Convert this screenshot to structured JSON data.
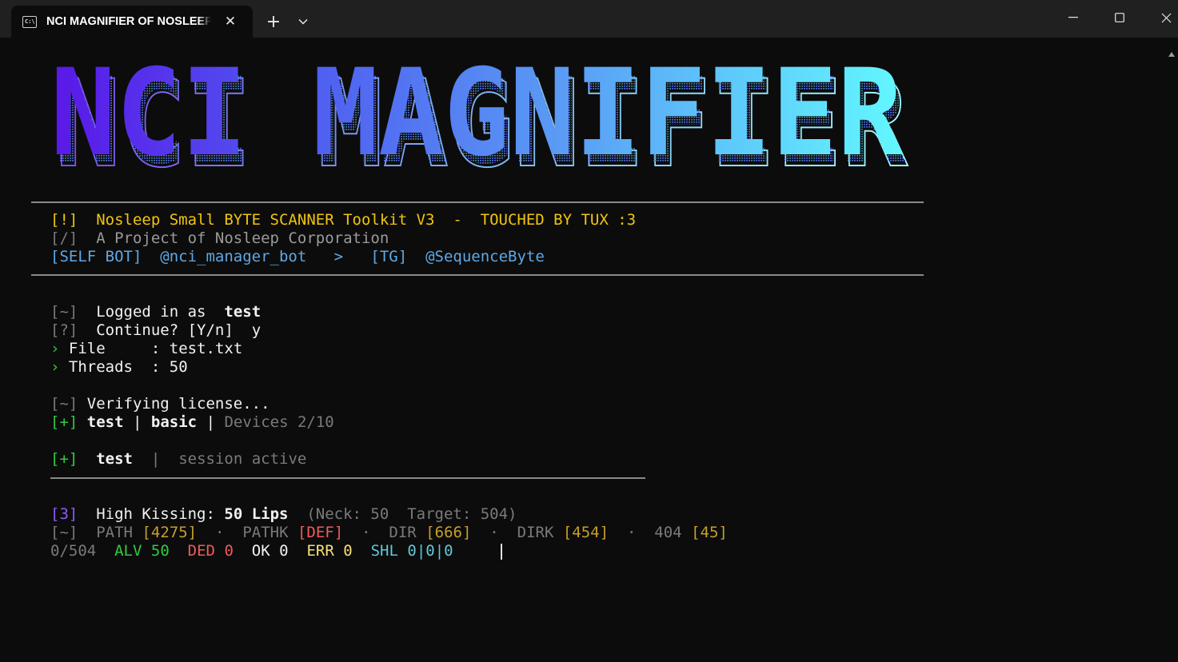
{
  "window": {
    "tab_title": "NCI MAGNIFIER OF NOSLEEP",
    "tab_icon_text": "C:\\",
    "close_glyph": "✕",
    "new_tab_glyph": "+"
  },
  "banner": {
    "text": "NCI MAGNIFIER",
    "gradient": [
      "#5a17e8",
      "#4f5cf0",
      "#5a9cf5",
      "#62f8ff"
    ]
  },
  "header": {
    "line1": {
      "tag": "[!]",
      "text": "Nosleep Small BYTE SCANNER Toolkit V3  -  TOUCHED BY TUX :3"
    },
    "line2": {
      "tag": "[/]",
      "text": "A Project of Nosleep Corporation"
    },
    "line3": {
      "self_bot_tag": "[SELF BOT]",
      "self_bot": "@nci_manager_bot",
      "arrow": ">",
      "tg_tag": "[TG]",
      "tg": "@SequenceByte"
    }
  },
  "session": {
    "login": {
      "tag": "[~]",
      "label": "Logged in as",
      "user": "test"
    },
    "continue": {
      "tag": "[?]",
      "label": "Continue? [Y/n]",
      "answer": "y"
    },
    "file": {
      "arrow": "›",
      "label": "File     :",
      "value": "test.txt"
    },
    "threads": {
      "arrow": "›",
      "label": "Threads  :",
      "value": "50"
    },
    "verify": {
      "tag": "[~]",
      "text": "Verifying license..."
    },
    "license": {
      "tag": "[+]",
      "user": "test",
      "sep1": "|",
      "plan": "basic",
      "sep2": "|",
      "devices": "Devices 2/10"
    },
    "active": {
      "tag": "[+]",
      "user": "test",
      "sep": "|",
      "status": "session active"
    }
  },
  "scan": {
    "mode": {
      "tag": "[3]",
      "label": "High Kissing:",
      "value": "50 Lips",
      "neck_label": "(Neck: 50",
      "target": "Target: 504)"
    },
    "paths": {
      "tag": "[~]",
      "path_label": "PATH",
      "path_val": "[4275]",
      "pathk_label": "PATHK",
      "pathk_val": "[DEF]",
      "dir_label": "DIR",
      "dir_val": "[666]",
      "dirk_label": "DIRK",
      "dirk_val": "[454]",
      "n404_label": "404",
      "n404_val": "[45]",
      "dot": "·"
    },
    "stats": {
      "progress": "0/504",
      "alv_label": "ALV",
      "alv": "50",
      "ded_label": "DED",
      "ded": "0",
      "ok_label": "OK",
      "ok": "0",
      "err_label": "ERR",
      "err": "0",
      "shl_label": "SHL",
      "shl": "0|0|0"
    }
  }
}
